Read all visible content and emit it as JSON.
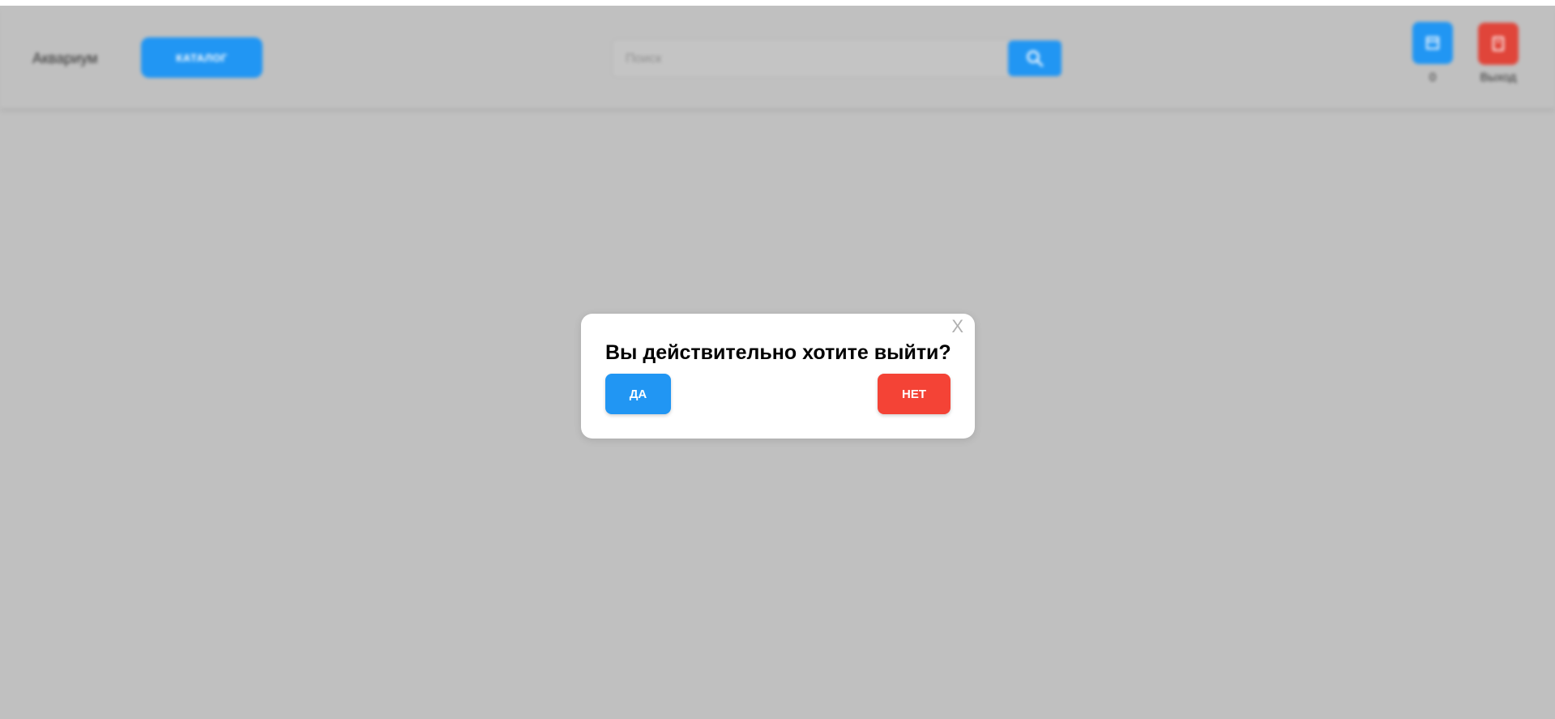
{
  "header": {
    "logo_text": "Аквариум",
    "catalog_label": "КАТАЛОГ",
    "search": {
      "placeholder": "Поиск",
      "value": ""
    },
    "cart": {
      "count": "0",
      "icon": "cart-icon"
    },
    "exit": {
      "label": "Выход",
      "icon": "exit-icon"
    }
  },
  "modal": {
    "title": "Вы действительно хотите выйти?",
    "close_label": "X",
    "yes_label": "ДА",
    "no_label": "НЕТ"
  },
  "colors": {
    "overlay": "#c0c0c0",
    "primary": "#2196f3",
    "danger": "#f44336"
  }
}
